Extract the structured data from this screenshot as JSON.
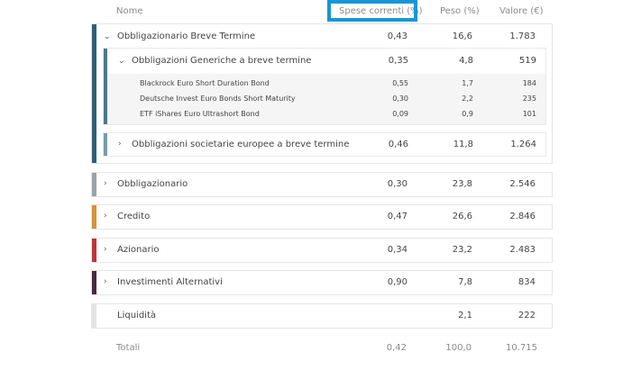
{
  "columns": {
    "name": "Nome",
    "expenses": "Spese correnti (%)",
    "weight": "Peso (%)",
    "value": "Valore (€)"
  },
  "groups": {
    "breve_termine": {
      "name": "Obbligazionario Breve Termine",
      "expenses": "0,43",
      "weight": "16,6",
      "value": "1.783",
      "color": "#315f73",
      "sub_generiche": {
        "name": "Obbligazioni Generiche a breve termine",
        "expenses": "0,35",
        "weight": "4,8",
        "value": "519",
        "color": "#4a7a8c",
        "funds": [
          {
            "name": "Blackrock Euro Short Duration Bond",
            "expenses": "0,55",
            "weight": "1,7",
            "value": "184"
          },
          {
            "name": "Deutsche Invest Euro Bonds Short Maturity",
            "expenses": "0,30",
            "weight": "2,2",
            "value": "235"
          },
          {
            "name": "ETF iShares Euro Ultrashort Bond",
            "expenses": "0,09",
            "weight": "0,9",
            "value": "101"
          }
        ]
      },
      "sub_societarie": {
        "name": "Obbligazioni societarie europee a breve termine",
        "expenses": "0,46",
        "weight": "11,8",
        "value": "1.264",
        "color": "#7a9aa8"
      }
    },
    "obbligazionario": {
      "name": "Obbligazionario",
      "expenses": "0,30",
      "weight": "23,8",
      "value": "2.546",
      "color": "#9aa3ab"
    },
    "credito": {
      "name": "Credito",
      "expenses": "0,47",
      "weight": "26,6",
      "value": "2.846",
      "color": "#d8913a"
    },
    "azionario": {
      "name": "Azionario",
      "expenses": "0,34",
      "weight": "23,2",
      "value": "2.483",
      "color": "#c0353a"
    },
    "alternativi": {
      "name": "Investimenti Alternativi",
      "expenses": "0,90",
      "weight": "7,8",
      "value": "834",
      "color": "#4a2842"
    },
    "liquidita": {
      "name": "Liquidità",
      "expenses": "",
      "weight": "2,1",
      "value": "222",
      "color": "#e3e3e3"
    }
  },
  "totals": {
    "label": "Totali",
    "expenses": "0,42",
    "weight": "100,0",
    "value": "10.715"
  },
  "icons": {
    "chevron_down": "chevron-down-icon",
    "chevron_right": "chevron-right-icon"
  }
}
